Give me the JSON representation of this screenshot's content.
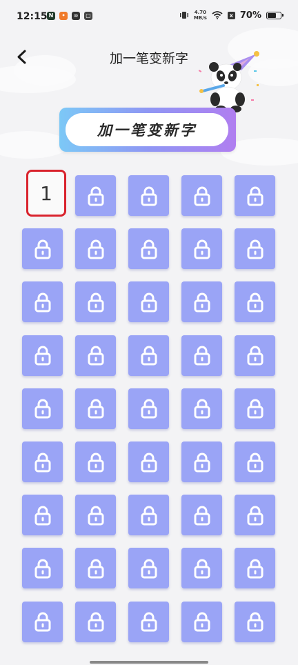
{
  "status_bar": {
    "time": "12:15",
    "net_speed_value": "4.70",
    "net_speed_unit": "MB/s",
    "battery_percent": "70%",
    "battery_level": 0.7
  },
  "header": {
    "title": "加一笔变新字"
  },
  "banner": {
    "title": "加一笔变新字"
  },
  "levels": {
    "columns": 5,
    "rows": 9,
    "unlocked": [
      {
        "index": 0,
        "label": "1"
      }
    ],
    "locked_icon": "lock-icon"
  },
  "colors": {
    "tile_locked": "#9aa4f6",
    "selected_border": "#d9232d",
    "banner_gradient_start": "#7cc8f6",
    "banner_gradient_end": "#b07ef0"
  }
}
